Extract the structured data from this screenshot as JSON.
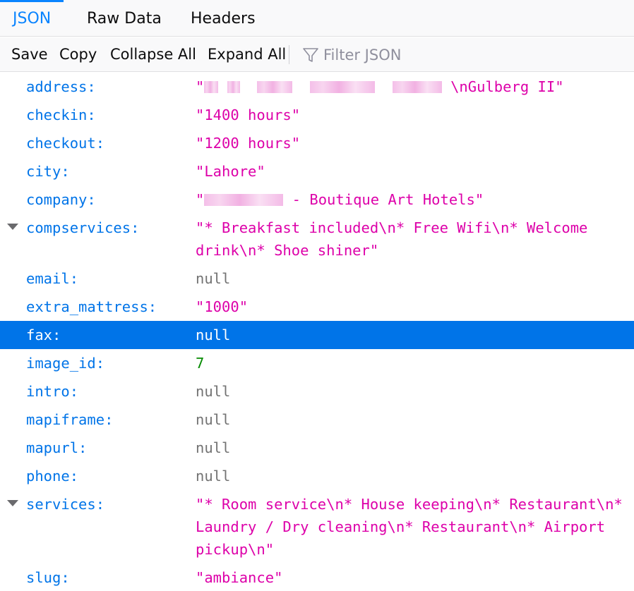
{
  "tabs": [
    {
      "label": "JSON",
      "active": true
    },
    {
      "label": "Raw Data",
      "active": false
    },
    {
      "label": "Headers",
      "active": false
    }
  ],
  "toolbar": {
    "save": "Save",
    "copy": "Copy",
    "collapse_all": "Collapse All",
    "expand_all": "Expand All",
    "filter_placeholder": "Filter JSON"
  },
  "rows": [
    {
      "key": "address:",
      "value_suffix": " \\nGulberg II\"",
      "value_prefix": "\"",
      "type": "string",
      "redacted": true
    },
    {
      "key": "checkin:",
      "value": "\"1400 hours\"",
      "type": "string"
    },
    {
      "key": "checkout:",
      "value": "\"1200 hours\"",
      "type": "string"
    },
    {
      "key": "city:",
      "value": "\"Lahore\"",
      "type": "string"
    },
    {
      "key": "company:",
      "value_prefix": "\"",
      "value_suffix": " - Boutique Art Hotels\"",
      "type": "string",
      "redacted": true
    },
    {
      "key": "compservices:",
      "value": "\"* Breakfast included\\n* Free Wifi\\n* Welcome drink\\n* Shoe shiner\"",
      "type": "string",
      "expandable": true
    },
    {
      "key": "email:",
      "value": "null",
      "type": "null"
    },
    {
      "key": "extra_mattress:",
      "value": "\"1000\"",
      "type": "string"
    },
    {
      "key": "fax:",
      "value": "null",
      "type": "null",
      "selected": true
    },
    {
      "key": "image_id:",
      "value": "7",
      "type": "number"
    },
    {
      "key": "intro:",
      "value": "null",
      "type": "null"
    },
    {
      "key": "mapiframe:",
      "value": "null",
      "type": "null"
    },
    {
      "key": "mapurl:",
      "value": "null",
      "type": "null"
    },
    {
      "key": "phone:",
      "value": "null",
      "type": "null"
    },
    {
      "key": "services:",
      "value": "\"* Room service\\n* House keeping\\n* Restaurant\\n* Laundry / Dry cleaning\\n* Restaurant\\n* Airport pickup\\n\"",
      "type": "string",
      "expandable": true
    },
    {
      "key": "slug:",
      "value": "\"ambiance\"",
      "type": "string"
    }
  ],
  "colors": {
    "accent": "#0a84ff",
    "key": "#0074e8",
    "string": "#dd00a9",
    "null": "#737373",
    "number": "#058b00",
    "selected_row": "#0074e8"
  }
}
